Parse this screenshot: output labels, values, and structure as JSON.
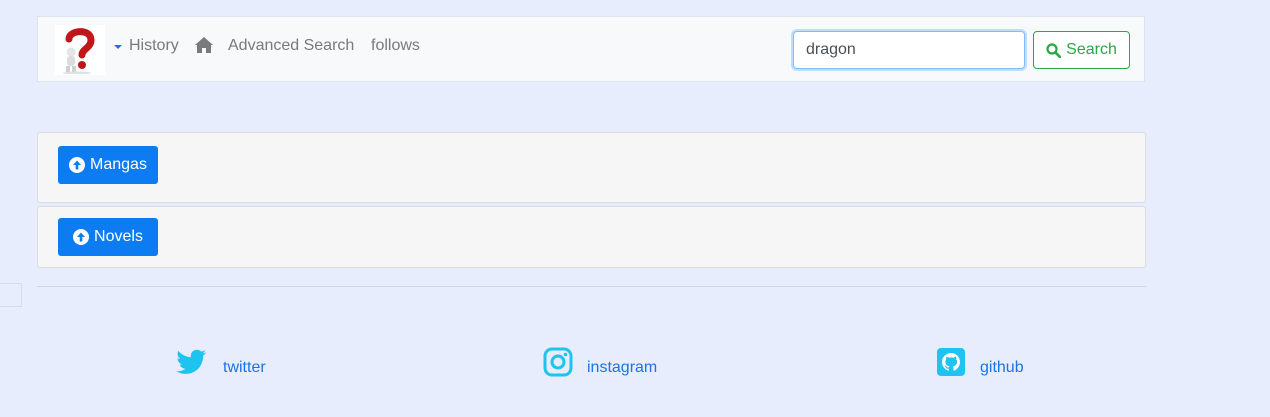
{
  "header": {
    "nav": {
      "history": "History",
      "advanced_search": "Advanced Search",
      "follows": "follows"
    },
    "search": {
      "value": "dragon",
      "button_label": "Search"
    }
  },
  "sections": {
    "mangas_label": "Mangas",
    "novels_label": "Novels"
  },
  "footer": {
    "twitter": "twitter",
    "instagram": "instagram",
    "github": "github"
  },
  "colors": {
    "page_bg": "#e8edfd",
    "primary": "#0d7cf2",
    "success": "#28a745",
    "social_icon": "#1fc3ef",
    "link": "#1a73e8"
  },
  "icons": [
    "question-mark-logo-icon",
    "caret-down-icon",
    "home-icon",
    "search-icon",
    "arrow-circle-up-icon",
    "twitter-icon",
    "instagram-icon",
    "github-icon"
  ]
}
